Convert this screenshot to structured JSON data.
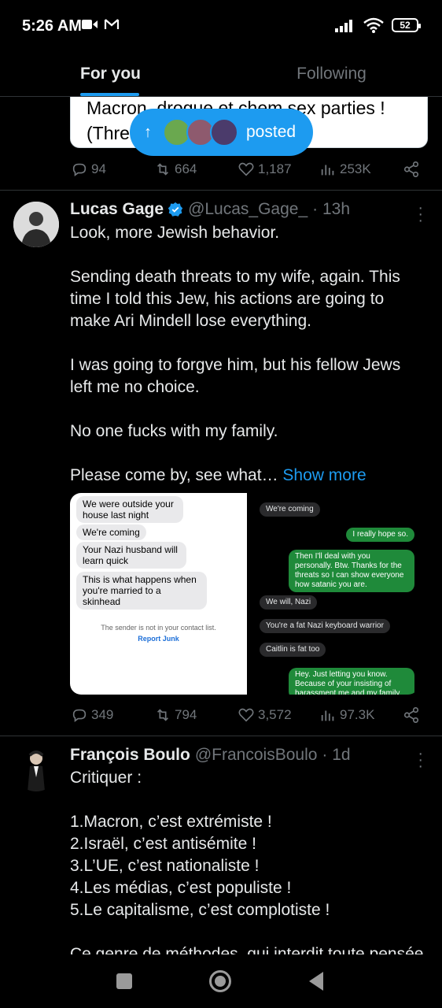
{
  "status": {
    "time": "5:26 AM",
    "battery": "52"
  },
  "tabs": [
    {
      "label": "For you"
    },
    {
      "label": "Following"
    }
  ],
  "quote": {
    "line1": "Macron, drogue et chem sex parties !",
    "line2": "(Thre"
  },
  "pill": {
    "label": "posted"
  },
  "tweet0": {
    "replies": "94",
    "reposts": "664",
    "likes": "1,187",
    "views": "253K"
  },
  "tweet1": {
    "name": "Lucas Gage",
    "handle": "@Lucas_Gage_",
    "time": "· 13h",
    "paragraphs": [
      "Look, more Jewish behavior.",
      "Sending death threats to my wife, again. This time I told this Jew, his actions are going to make Ari Mindell lose everything.",
      "I was going to forgve him, but his fellow Jews left me no choice.",
      "No one fucks with my family.",
      "Please come by, see what…"
    ],
    "show_more": "Show more",
    "media_left": {
      "bubbles": [
        "We were outside your house last night",
        "We're coming",
        "Your Nazi husband will learn quick",
        "This is what happens when you're married to a skinhead"
      ],
      "sender_note": "The sender is not in your contact list.",
      "report": "Report Junk"
    },
    "media_right": {
      "bubbles": [
        "We're coming",
        "I really hope so.",
        "Then I'll deal with you personally. Btw. Thanks for the threats so I can show everyone how satanic you are.",
        "We will, Nazi",
        "You're a fat Nazi keyboard warrior",
        "Caitlin is fat too",
        "Hey. Just letting you know. Because of your insisting of harassment me and my family will will press charges"
      ]
    },
    "replies": "349",
    "reposts": "794",
    "likes": "3,572",
    "views": "97.3K"
  },
  "tweet2": {
    "name": "François Boulo",
    "handle": "@FrancoisBoulo",
    "time": "· 1d",
    "lines": [
      "Critiquer :",
      "",
      "1.Macron, c’est extrémiste !",
      "2.Israël, c’est antisémite !",
      "3.L’UE, c’est nationaliste !",
      "4.Les médias, c’est populiste !",
      "5.Le capitalisme, c’est complotiste !",
      "",
      "Ce genre de méthodes, qui interdit toute pensée"
    ]
  },
  "colors": {
    "accent": "#1d9bf0",
    "muted": "#71767b",
    "background": "#000000",
    "divider": "#2f3336"
  }
}
